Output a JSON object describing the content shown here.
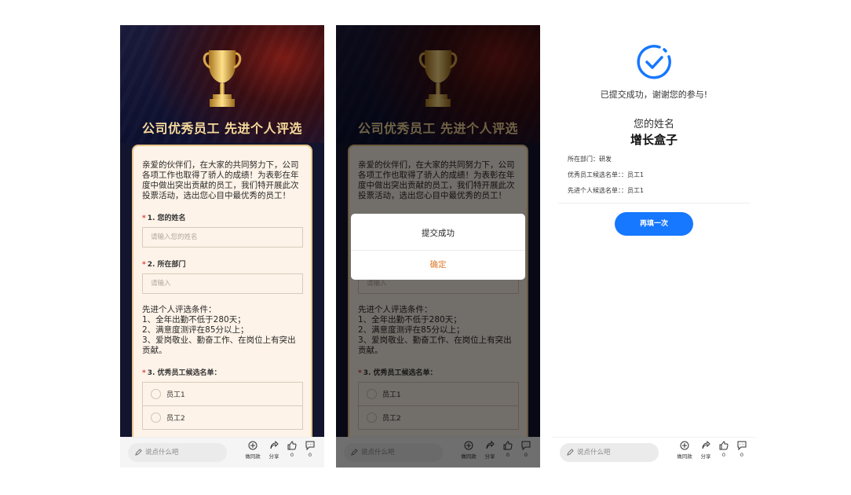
{
  "form": {
    "title": "公司优秀员工 先进个人评选",
    "intro": "亲爱的伙伴们，在大家的共同努力下，公司各项工作也取得了骄人的成绩！为表彰在年度中做出突出贡献的员工，我们特开展此次投票活动，选出您心目中最优秀的员工！",
    "q1_label": "1. 您的姓名",
    "q1_placeholder": "请输入您的姓名",
    "q2_label": "2. 所在部门",
    "q2_placeholder": "请输入",
    "criteria": "先进个人评选条件：\n1、全年出勤不低于280天；\n2、满意度测评在85分以上；\n3、爱岗敬业、勤奋工作、在岗位上有突出贡献。",
    "q3_label": "3. 优秀员工候选名单：",
    "required_mark": "*",
    "options": [
      "员工1",
      "员工2"
    ]
  },
  "bottombar": {
    "comment_placeholder": "说点什么吧",
    "create_label": "做同款",
    "share_label": "分享",
    "like_count": "0",
    "comment_count": "0"
  },
  "modal": {
    "message": "提交成功",
    "confirm": "确定"
  },
  "result": {
    "success_message": "已提交成功，谢谢您的参与!",
    "name_label": "您的姓名",
    "name_value": "增长盒子",
    "dept_row": "所在部门：研发",
    "excellent_row": "优秀员工候选名单：：员工1",
    "advanced_row": "先进个人候选名单：：员工1",
    "again_button": "再填一次"
  },
  "colors": {
    "accent_gold": "#f5d99a",
    "card_bg": "#fdf3e8",
    "primary_blue": "#1677ff",
    "confirm_orange": "#e07a2a"
  }
}
